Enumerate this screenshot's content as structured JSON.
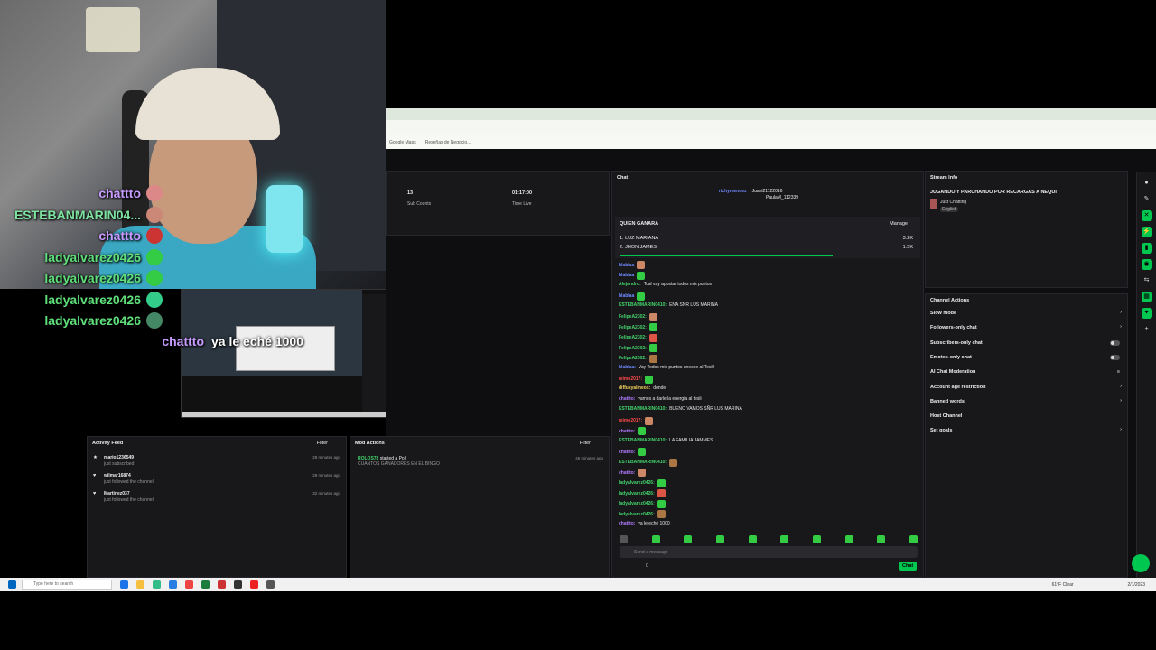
{
  "overlay_chat": [
    {
      "user": "chattto",
      "color": "#c79bff",
      "msg": "",
      "emote": "#d88"
    },
    {
      "user": "ESTEBANMARIN04...",
      "color": "#7ee3a0",
      "msg": "",
      "emote": "#c87"
    },
    {
      "user": "chattto",
      "color": "#c79bff",
      "msg": "",
      "emote": "#c33"
    },
    {
      "user": "ladyalvarez0426",
      "color": "#5fe07a",
      "msg": "",
      "emote": "#3c4"
    },
    {
      "user": "ladyalvarez0426",
      "color": "#5fe07a",
      "msg": "",
      "emote": "#3c4"
    },
    {
      "user": "ladyalvarez0426",
      "color": "#5fe07a",
      "msg": "",
      "emote": "#3c8"
    },
    {
      "user": "ladyalvarez0426",
      "color": "#5fe07a",
      "msg": "",
      "emote": "#486"
    },
    {
      "user": "chattto",
      "color": "#c79bff",
      "msg": "ya le eché 1000",
      "emote": ""
    }
  ],
  "browser": {
    "bookmarks": [
      "Google Maps",
      "Reseñas de Negocio..."
    ]
  },
  "stats": {
    "sub_count_value": "13",
    "sub_count_label": "Sub Counts",
    "time_value": "01:17:00",
    "time_label": "Time Live"
  },
  "chat": {
    "title": "Chat",
    "top_gifters": [
      "richymendez",
      "Juani21122016",
      "PaulaM_112339"
    ],
    "poll_title": "QUIEN GANARA",
    "manage_label": "Manage",
    "poll_options": [
      {
        "name": "1. LUZ MARIANA",
        "points": "3.2K"
      },
      {
        "name": "2. JHON JAMES",
        "points": "1.5K"
      }
    ],
    "messages": [
      {
        "user": "blablaa",
        "cls": "u-blue",
        "text": ""
      },
      {
        "user": "blablaa",
        "cls": "u-blue",
        "text": ""
      },
      {
        "user": "Alejandro:",
        "cls": "u-green",
        "text": "Tcal vay apostar todos mis puntos"
      },
      {
        "user": "blablaa",
        "cls": "u-blue",
        "text": ""
      },
      {
        "user": "ESTEBANMARIN0410:",
        "cls": "u-green",
        "text": "ENA SÑR LUS MARINA"
      },
      {
        "user": "FelipeA2302:",
        "cls": "u-green",
        "text": ""
      },
      {
        "user": "FelipeA2302:",
        "cls": "u-green",
        "text": ""
      },
      {
        "user": "FelipeA2302:",
        "cls": "u-green",
        "text": ""
      },
      {
        "user": "FelipeA2302:",
        "cls": "u-green",
        "text": ""
      },
      {
        "user": "FelipeA2302:",
        "cls": "u-green",
        "text": ""
      },
      {
        "user": "blablaa:",
        "cls": "u-blue",
        "text": "Vay Todos mis puntos unecee al Teslil"
      },
      {
        "user": "mimo2017:",
        "cls": "u-red",
        "text": ""
      },
      {
        "user": "diffusyalmeos:",
        "cls": "u-yellow",
        "text": "donde"
      },
      {
        "user": "chattto:",
        "cls": "u-purple",
        "text": "vamos a darle la energia al tesli"
      },
      {
        "user": "ESTEBANMARIN0410:",
        "cls": "u-green",
        "text": "BUENO VAMOS SÑR LUS MARINA"
      },
      {
        "user": "mimo2017:",
        "cls": "u-red",
        "text": ""
      },
      {
        "user": "chattto:",
        "cls": "u-purple",
        "text": ""
      },
      {
        "user": "ESTEBANMARIN0410:",
        "cls": "u-green",
        "text": "LA FAMILIA JAMMES"
      },
      {
        "user": "chattto:",
        "cls": "u-purple",
        "text": ""
      },
      {
        "user": "ESTEBANMARIN0410:",
        "cls": "u-green",
        "text": ""
      },
      {
        "user": "chattto:",
        "cls": "u-purple",
        "text": ""
      },
      {
        "user": "ladyalvarez0426:",
        "cls": "u-green",
        "text": ""
      },
      {
        "user": "ladyalvarez0426:",
        "cls": "u-green",
        "text": ""
      },
      {
        "user": "ladyalvarez0426:",
        "cls": "u-green",
        "text": ""
      },
      {
        "user": "ladyalvarez0426:",
        "cls": "u-green",
        "text": ""
      },
      {
        "user": "chattto:",
        "cls": "u-purple",
        "text": "ya le eché 1000"
      }
    ],
    "input_placeholder": "Send a message",
    "points_value": "0",
    "chat_button": "Chat"
  },
  "stream_info": {
    "title": "Stream Info",
    "stream_title": "JUGANDO Y PARCHANDO POR RECARGAS A NEQUI",
    "category": "Just Chatting",
    "language": "English"
  },
  "channel_actions": {
    "title": "Channel Actions",
    "items": [
      {
        "label": "Slow mode",
        "ctrl": "chevron"
      },
      {
        "label": "Followers-only chat",
        "ctrl": "chevron"
      },
      {
        "label": "Subscribers-only chat",
        "ctrl": "toggle"
      },
      {
        "label": "Emotes-only chat",
        "ctrl": "toggle"
      },
      {
        "label": "AI Chat Moderation",
        "ctrl": "settings"
      },
      {
        "label": "Account age restriction",
        "ctrl": "chevron"
      },
      {
        "label": "Banned words",
        "ctrl": "chevron"
      },
      {
        "label": "Host Channel",
        "ctrl": ""
      },
      {
        "label": "Set goals",
        "ctrl": "chevron"
      }
    ]
  },
  "activity_feed": {
    "title": "Activity Feed",
    "filter": "Filter",
    "items": [
      {
        "name": "mario1236549",
        "action": "just subscribed",
        "time": "28 minutes ago"
      },
      {
        "name": "wilmar16874",
        "action": "just followed the channel",
        "time": "29 minutes ago"
      },
      {
        "name": "Martinez037",
        "action": "just followed the channel",
        "time": "32 minutes ago"
      }
    ]
  },
  "mod_actions": {
    "title": "Mod Actions",
    "filter": "Filter",
    "items": [
      {
        "user": "ROLOS78",
        "action": "started a Poll",
        "detail": "CUANTOS GANADORES EN EL BINGO",
        "time": "46 minutes ago"
      }
    ]
  },
  "taskbar": {
    "search_placeholder": "Type here to search",
    "tray_text": "61°F Clear",
    "clock": "2/1/2023"
  },
  "colors": {
    "accent": "#00c74f",
    "panel": "#18181b",
    "bg": "#0e0e10"
  }
}
